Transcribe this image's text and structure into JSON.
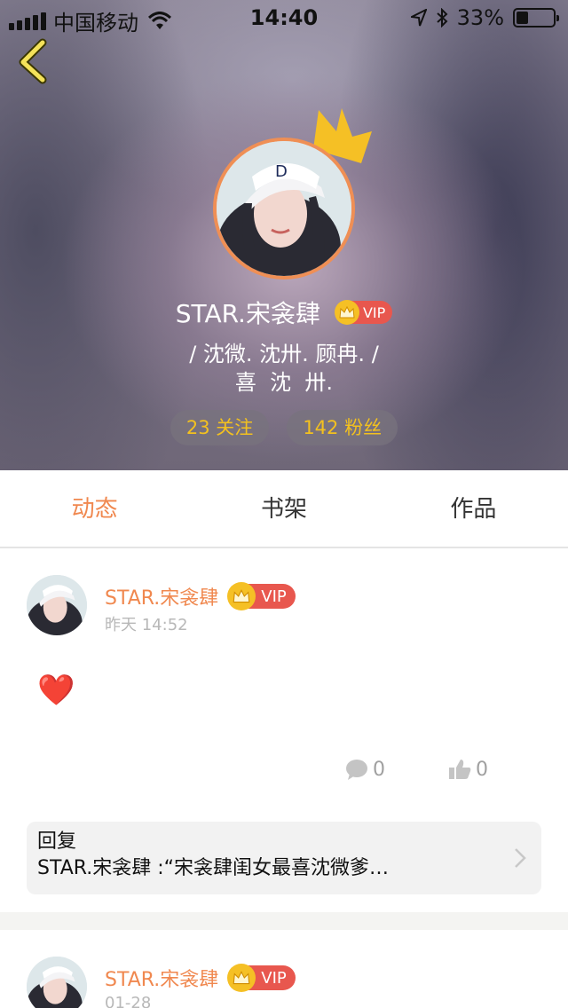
{
  "status_bar": {
    "carrier": "中国移动",
    "time": "14:40",
    "battery_percent": "33%",
    "battery_level": 0.33,
    "icons": [
      "signal-icon",
      "wifi-icon",
      "location-icon",
      "bluetooth-icon",
      "battery-icon"
    ]
  },
  "profile": {
    "nickname": "STAR.宋衾肆",
    "vip_label": "VIP",
    "signature_line1": "/ 沈微. 沈卅. 顾冉. /",
    "signature_line2": "喜  沈  卅.",
    "following": "23 关注",
    "followers": "142 粉丝"
  },
  "tabs": [
    {
      "label": "动态",
      "active": true
    },
    {
      "label": "书架",
      "active": false
    },
    {
      "label": "作品",
      "active": false
    }
  ],
  "posts": [
    {
      "name": "STAR.宋衾肆",
      "vip_label": "VIP",
      "time": "昨天 14:52",
      "content": "❤️",
      "comments": "0",
      "likes": "0",
      "reply_label": "回复",
      "reply_text": "STAR.宋衾肆 :“宋衾肆闺女最喜沈微爹…"
    },
    {
      "name": "STAR.宋衾肆",
      "vip_label": "VIP",
      "time": "01-28"
    }
  ],
  "colors": {
    "accent": "#f0884f",
    "vip_red": "#e8574e",
    "gold": "#f5c025",
    "stat_text": "#f3c11f"
  }
}
